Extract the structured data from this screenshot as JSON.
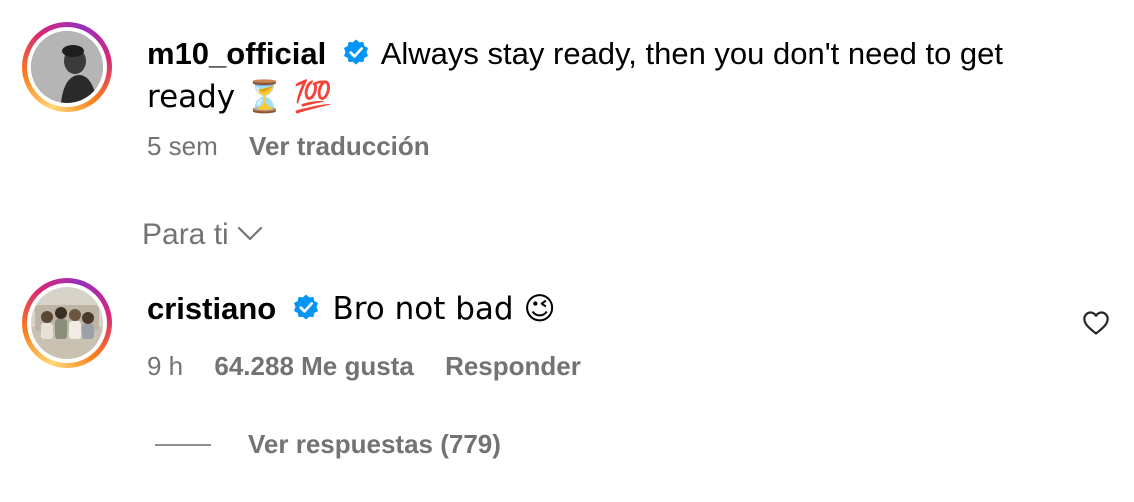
{
  "comment1": {
    "username": "m10_official",
    "text_line1": "Always stay ready, then you don't need to get",
    "text_line2": "ready ⏳ 💯",
    "time": "5 sem",
    "translate": "Ver traducción"
  },
  "section": {
    "label": "Para ti"
  },
  "comment2": {
    "username": "cristiano",
    "text": "Bro not bad 😉",
    "time": "9 h",
    "likes": "64.288 Me gusta",
    "reply": "Responder",
    "view_replies": "Ver respuestas (779)"
  },
  "icons": {
    "verified": "verified-badge-icon",
    "chevron": "chevron-down-icon",
    "heart": "heart-icon"
  },
  "colors": {
    "verified_blue": "#0095f6",
    "meta_gray": "#737373",
    "text": "#000000"
  }
}
